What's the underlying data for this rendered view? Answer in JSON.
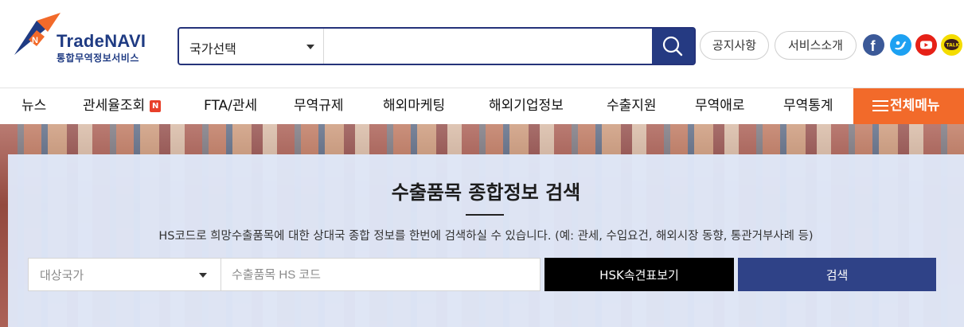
{
  "brand": {
    "name": "TradeNAVI",
    "subtitle": "통합무역정보서비스",
    "colors": {
      "navy": "#253a82",
      "orange": "#f26a2a"
    }
  },
  "search": {
    "country_label": "국가선택",
    "placeholder": "",
    "button_icon": "search-icon"
  },
  "utility": {
    "notice": "공지사항",
    "service": "서비스소개",
    "sns": [
      "facebook-icon",
      "twitter-icon",
      "youtube-icon",
      "kakaotalk-icon"
    ],
    "kakao_label": "TALK"
  },
  "nav": {
    "items": [
      {
        "label": "뉴스"
      },
      {
        "label": "관세율조회",
        "badge": "N"
      },
      {
        "label": "FTA/관세"
      },
      {
        "label": "무역규제"
      },
      {
        "label": "해외마케팅"
      },
      {
        "label": "해외기업정보"
      },
      {
        "label": "수출지원"
      },
      {
        "label": "무역애로"
      },
      {
        "label": "무역통계"
      }
    ],
    "all_menu": "전체메뉴"
  },
  "hero": {
    "title": "수출품목 종합정보 검색",
    "description": "HS코드로 희망수출품목에 대한 상대국 종합 정보를 한번에 검색하실 수 있습니다. (예: 관세, 수입요건, 해외시장 동향, 통관거부사례 등)",
    "country_select": "대상국가",
    "hs_placeholder": "수출품목 HS 코드",
    "hsk_button": "HSK속견표보기",
    "search_button": "검색"
  }
}
